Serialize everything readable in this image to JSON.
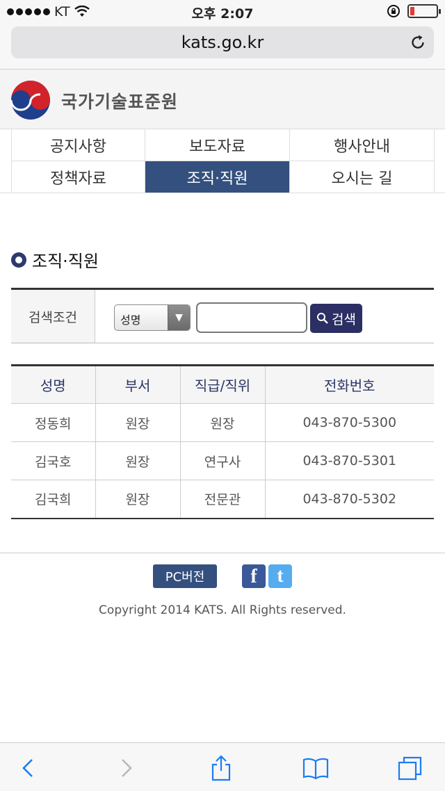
{
  "status_bar": {
    "carrier": "KT",
    "time": "오후 2:07"
  },
  "browser": {
    "url": "kats.go.kr"
  },
  "site": {
    "logo_text": "국가기술표준원"
  },
  "nav": {
    "items": [
      {
        "label": "공지사항",
        "active": false
      },
      {
        "label": "보도자료",
        "active": false
      },
      {
        "label": "행사안내",
        "active": false
      },
      {
        "label": "정책자료",
        "active": false
      },
      {
        "label": "조직·직원",
        "active": true
      },
      {
        "label": "오시는 길",
        "active": false
      }
    ]
  },
  "section": {
    "title": "조직·직원"
  },
  "search": {
    "label": "검색조건",
    "select_value": "성명",
    "input_value": "",
    "button_label": "검색"
  },
  "table": {
    "headers": [
      "성명",
      "부서",
      "직급/직위",
      "전화번호"
    ],
    "rows": [
      [
        "정동희",
        "원장",
        "원장",
        "043-870-5300"
      ],
      [
        "김국호",
        "원장",
        "연구사",
        "043-870-5301"
      ],
      [
        "김국희",
        "원장",
        "전문관",
        "043-870-5302"
      ]
    ]
  },
  "footer": {
    "pc_button": "PC버전",
    "facebook_glyph": "f",
    "twitter_glyph": "t",
    "copyright": "Copyright 2014 KATS. All Rights reserved."
  },
  "colors": {
    "nav_active": "#34507f",
    "search_button": "#2b2f63",
    "facebook": "#3b5998",
    "twitter": "#55acee",
    "ios_blue": "#1a7cf5"
  }
}
